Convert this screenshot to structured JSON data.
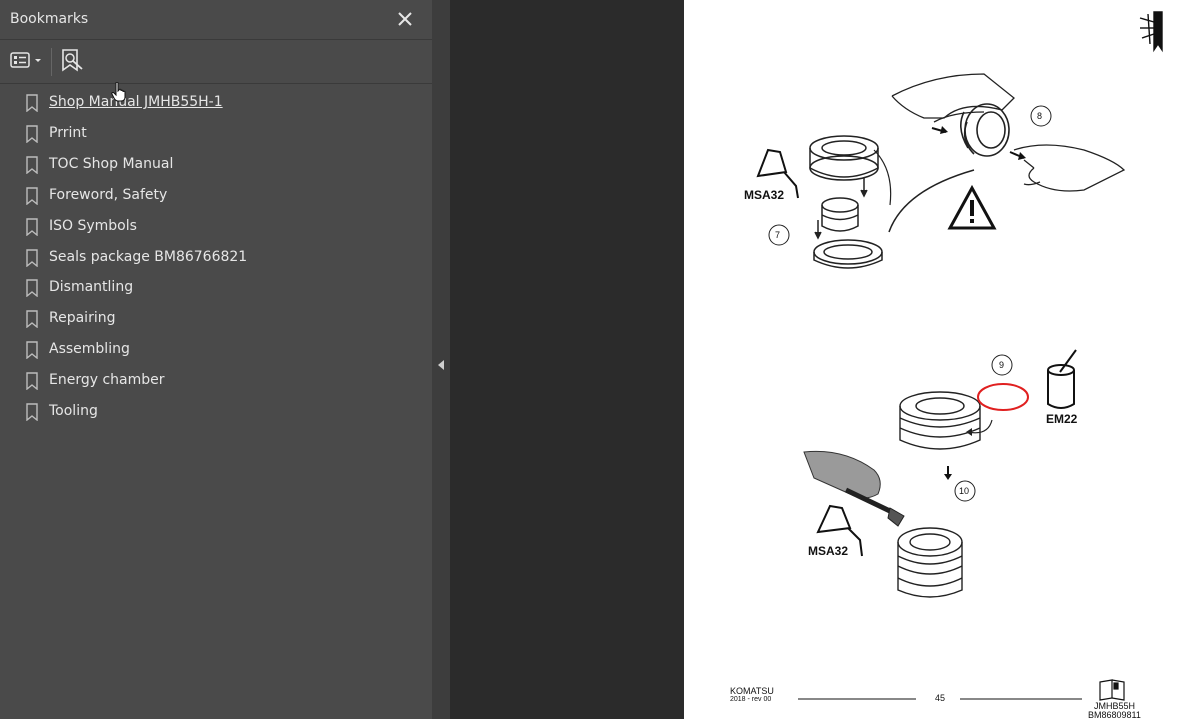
{
  "panel": {
    "title": "Bookmarks",
    "toolbar": {
      "options_icon": "list-options-icon",
      "find_icon": "find-bookmark-icon"
    }
  },
  "bookmarks": [
    {
      "label": "Shop Manual JMHB55H-1",
      "selected": true
    },
    {
      "label": "Prrint"
    },
    {
      "label": "TOC Shop Manual"
    },
    {
      "label": "Foreword, Safety"
    },
    {
      "label": "ISO Symbols"
    },
    {
      "label": "Seals package BM86766821"
    },
    {
      "label": "Dismantling"
    },
    {
      "label": "Repairing"
    },
    {
      "label": "Assembling"
    },
    {
      "label": "Energy chamber"
    },
    {
      "label": "Tooling"
    }
  ],
  "page": {
    "callouts": {
      "c7": "7",
      "c8": "8",
      "c9": "9",
      "c10": "10"
    },
    "labels": {
      "msa32_top": "MSA32",
      "em22": "EM22",
      "msa32_bottom": "MSA32"
    },
    "footer": {
      "brand": "KOMATSU",
      "revision": "2018 -   rev 00",
      "page_number": "45",
      "model": "JMHB55H",
      "doc_code": "BM86809811"
    }
  },
  "colors": {
    "panel_bg": "#4a4a4a",
    "doc_bg": "#2b2b2b",
    "text": "#e6e6e6",
    "highlight_ring": "#e02020"
  }
}
